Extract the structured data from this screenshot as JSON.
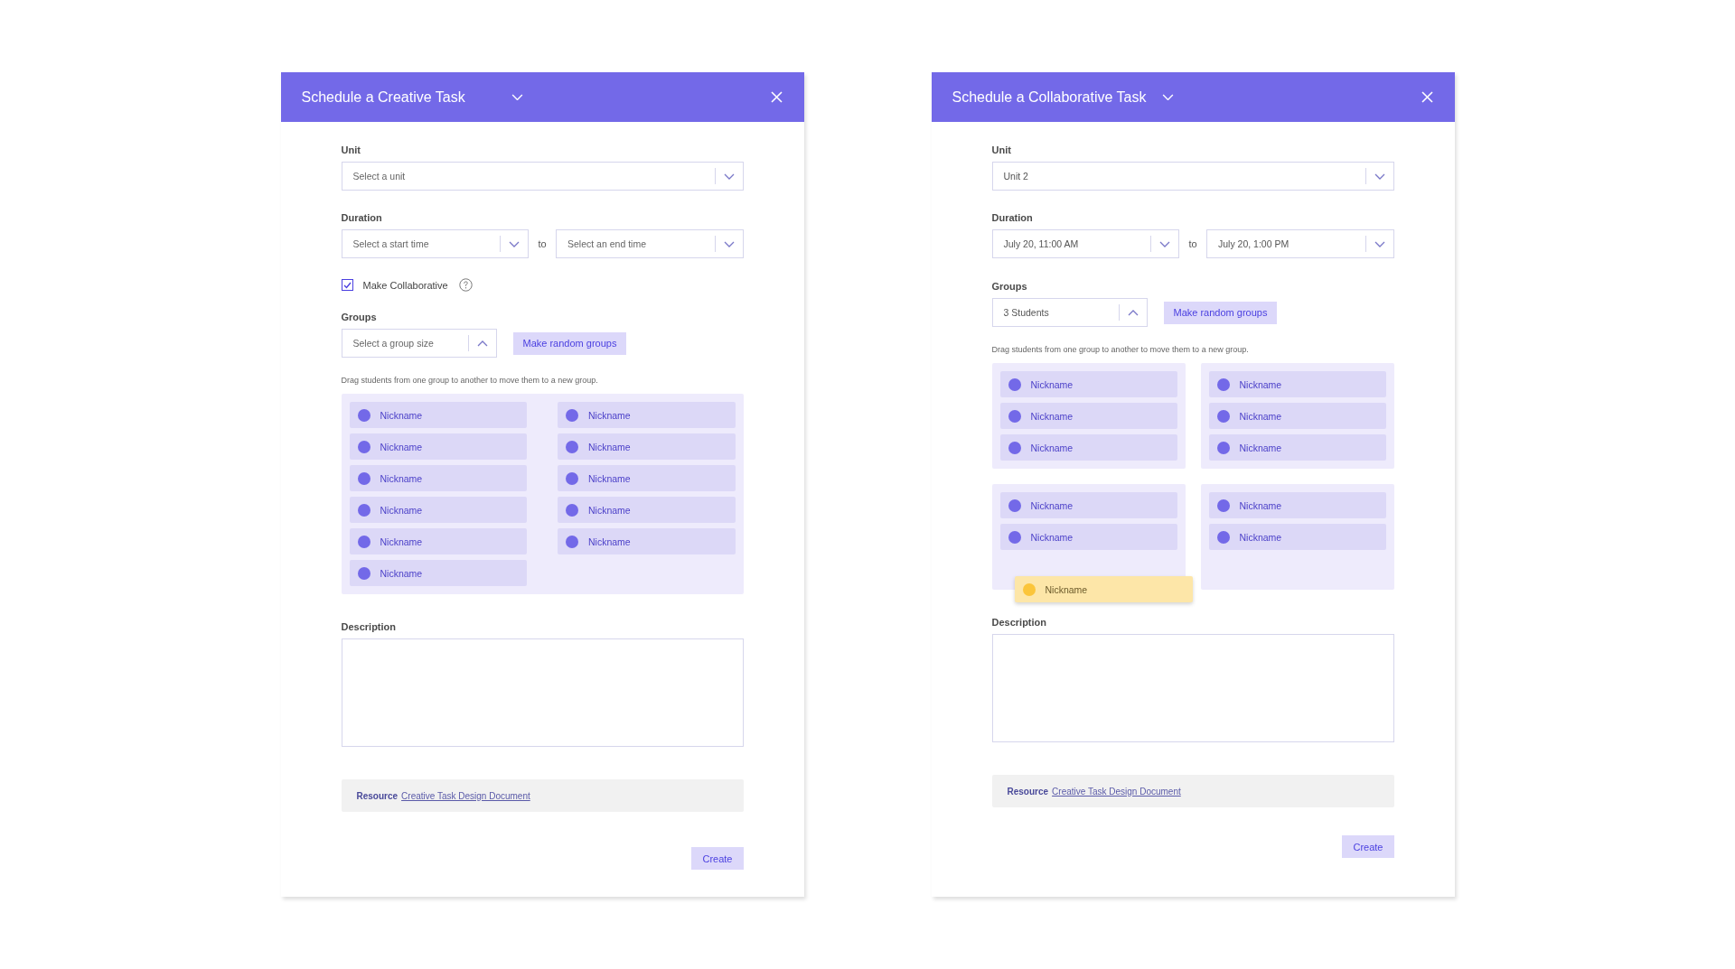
{
  "dialogs": [
    {
      "title": "Schedule a Creative Task",
      "unit": {
        "label": "Unit",
        "placeholder": "Select a unit",
        "expanded": false
      },
      "duration": {
        "label": "Duration",
        "start": {
          "placeholder": "Select a start time",
          "expanded": false
        },
        "separator": "to",
        "end": {
          "placeholder": "Select an end time",
          "expanded": false
        }
      },
      "collaborative": {
        "label": "Make Collaborative",
        "checked": true
      },
      "groups": {
        "label": "Groups",
        "size": {
          "placeholder": "Select a group size",
          "expanded": true
        },
        "button": "Make random groups",
        "hint": "Drag students from one group to another to move them to a new group.",
        "kind": "pool",
        "lists": [
          {
            "students": [
              "Nickname",
              "Nickname",
              "Nickname",
              "Nickname",
              "Nickname",
              "Nickname",
              "Nickname",
              "Nickname",
              "Nickname",
              "Nickname",
              "Nickname"
            ]
          }
        ]
      },
      "description": {
        "label": "Description"
      },
      "resource": {
        "label": "Resource",
        "link": "Creative Task Design Document"
      },
      "button": "Create"
    },
    {
      "title": "Schedule a Collaborative Task",
      "unit": {
        "label": "Unit",
        "value": "Unit 2",
        "expanded": false
      },
      "duration": {
        "label": "Duration",
        "start": {
          "value": "July 20, 11:00 AM",
          "expanded": false
        },
        "separator": "to",
        "end": {
          "value": "July 20, 1:00 PM",
          "expanded": false
        }
      },
      "groups": {
        "label": "Groups",
        "size": {
          "value": "3 Students",
          "expanded": true
        },
        "button": "Make random groups",
        "hint": "Drag students from one group to another to move them to a new group.",
        "kind": "cards",
        "lists": [
          {
            "students": [
              "Nickname",
              "Nickname",
              "Nickname"
            ]
          },
          {
            "students": [
              "Nickname",
              "Nickname",
              "Nickname"
            ]
          },
          {
            "students": [
              "Nickname",
              "Nickname"
            ]
          },
          {
            "students": [
              "Nickname",
              "Nickname"
            ]
          }
        ],
        "dragging": {
          "name": "Nickname"
        }
      },
      "description": {
        "label": "Description"
      },
      "resource": {
        "label": "Resource",
        "link": "Creative Task Design Document"
      },
      "button": "Create"
    }
  ]
}
